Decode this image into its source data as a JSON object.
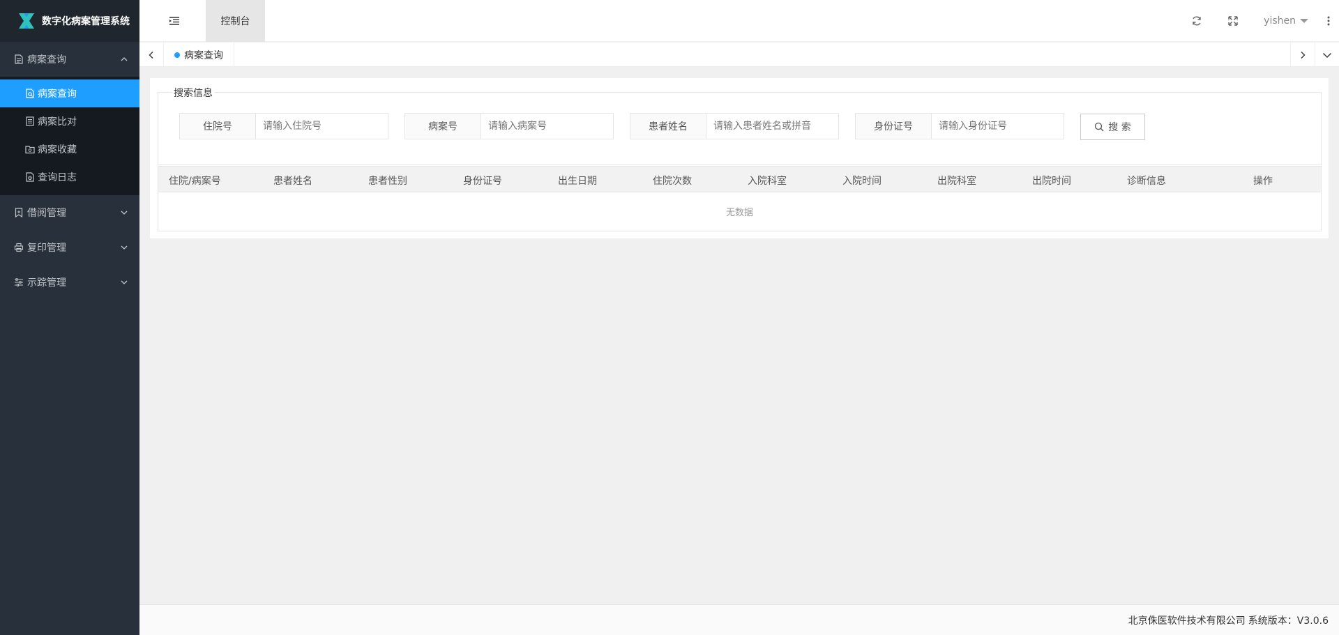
{
  "app": {
    "title": "数字化病案管理系统"
  },
  "sidebar": {
    "groups": [
      {
        "label": "病案查询",
        "icon": "file-doc-icon",
        "expanded": true,
        "items": [
          {
            "label": "病案查询",
            "icon": "file-search-icon",
            "active": true
          },
          {
            "label": "病案比对",
            "icon": "file-compare-icon"
          },
          {
            "label": "病案收藏",
            "icon": "folder-star-icon"
          },
          {
            "label": "查询日志",
            "icon": "file-log-icon"
          }
        ]
      },
      {
        "label": "借阅管理",
        "icon": "bookmark-icon",
        "expanded": false
      },
      {
        "label": "复印管理",
        "icon": "printer-icon",
        "expanded": false
      },
      {
        "label": "示踪管理",
        "icon": "sliders-icon",
        "expanded": false
      }
    ]
  },
  "header": {
    "console_tab": "控制台",
    "username": "yishen"
  },
  "tabs": {
    "current": "病案查询"
  },
  "search": {
    "legend": "搜索信息",
    "fields": [
      {
        "label": "住院号",
        "placeholder": "请输入住院号"
      },
      {
        "label": "病案号",
        "placeholder": "请输入病案号"
      },
      {
        "label": "患者姓名",
        "placeholder": "请输入患者姓名或拼音"
      },
      {
        "label": "身份证号",
        "placeholder": "请输入身份证号"
      }
    ],
    "button": "搜 索"
  },
  "table": {
    "columns": [
      "住院/病案号",
      "患者姓名",
      "患者性别",
      "身份证号",
      "出生日期",
      "住院次数",
      "入院科室",
      "入院时间",
      "出院科室",
      "出院时间",
      "诊断信息",
      "操作"
    ],
    "empty_text": "无数据"
  },
  "footer": {
    "company": "北京侏医软件技术有限公司",
    "version": "系统版本：V3.0.6"
  },
  "colors": {
    "sidebar_bg": "#28313b",
    "active_item": "#1e9fff",
    "accent": "#1e9fff"
  }
}
